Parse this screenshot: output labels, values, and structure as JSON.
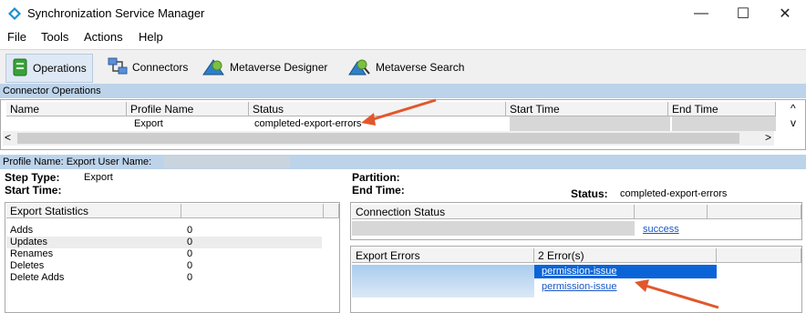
{
  "window": {
    "title": "Synchronization Service Manager",
    "minimize": "—",
    "maximize": "☐",
    "close": "✕"
  },
  "menu": [
    "File",
    "Tools",
    "Actions",
    "Help"
  ],
  "toolbar": [
    {
      "label": "Operations",
      "icon": "operations-icon"
    },
    {
      "label": "Connectors",
      "icon": "connectors-icon"
    },
    {
      "label": "Metaverse Designer",
      "icon": "metaverse-designer-icon"
    },
    {
      "label": "Metaverse Search",
      "icon": "metaverse-search-icon"
    }
  ],
  "connector_operations": {
    "title": "Connector Operations",
    "columns": [
      "Name",
      "Profile Name",
      "Status",
      "Start Time",
      "End Time"
    ],
    "rows": [
      {
        "name": "",
        "profile": "Export",
        "status": "completed-export-errors",
        "start": "",
        "end": ""
      }
    ],
    "scroll_left": "<",
    "scroll_right": ">",
    "scroll_up": "^",
    "scroll_down": "v"
  },
  "profile_bar": "Profile Name: Export  User Name:",
  "details": {
    "step_type_label": "Step Type:",
    "step_type_value": "Export",
    "start_time_label": "Start Time:",
    "partition_label": "Partition:",
    "end_time_label": "End Time:",
    "status_label": "Status:",
    "status_value": "completed-export-errors"
  },
  "export_statistics": {
    "header": "Export Statistics",
    "rows": [
      {
        "label": "Adds",
        "value": "0"
      },
      {
        "label": "Updates",
        "value": "0"
      },
      {
        "label": "Renames",
        "value": "0"
      },
      {
        "label": "Deletes",
        "value": "0"
      },
      {
        "label": "Delete Adds",
        "value": "0"
      }
    ]
  },
  "connection_status": {
    "header": "Connection Status",
    "link": "success"
  },
  "export_errors": {
    "header": "Export Errors",
    "count": "2 Error(s)",
    "items": [
      "permission-issue",
      "permission-issue"
    ]
  },
  "colors": {
    "section_bar": "#bcd3ea",
    "selection": "#0a64d8",
    "arrow": "#e2572b",
    "link": "#1a57c7"
  }
}
